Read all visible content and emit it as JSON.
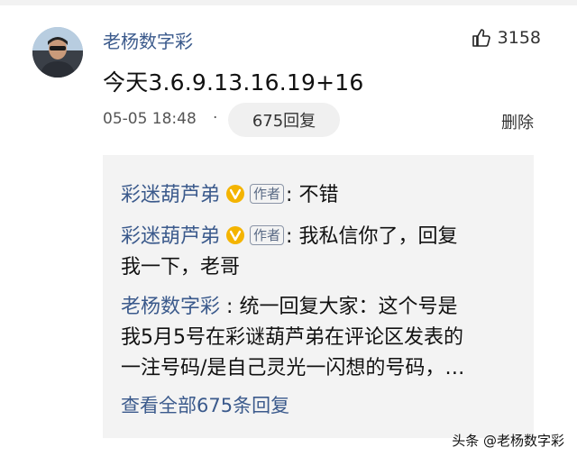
{
  "comment": {
    "username": "老杨数字彩",
    "like_count": "3158",
    "text": "今天3.6.9.13.16.19+16",
    "timestamp": "05-05 18:48",
    "separator": "·",
    "reply_count_label": "675回复",
    "delete_label": "删除"
  },
  "replies": [
    {
      "name": "彩迷葫芦弟",
      "tag": "作者",
      "text": "不错"
    },
    {
      "name": "彩迷葫芦弟",
      "tag": "作者",
      "text_line1": "我私信你了，回复",
      "text_line2": "我一下，老哥"
    },
    {
      "name": "老杨数字彩",
      "text_line1": "统一回复大家：这个号是",
      "text_line2": "我5月5号在彩谜葫芦弟在评论区发表的",
      "text_line3": "一注号码/是自己灵光一闪想的号码，…"
    }
  ],
  "colon": ":",
  "view_all_label": "查看全部675条回复",
  "watermark": "头条 @老杨数字彩",
  "colors": {
    "name": "#3b5a8c",
    "badge": "#f4b400",
    "reply_bg": "#f3f3f3"
  },
  "icons": {
    "like": "thumbs-up-icon",
    "verified": "verified-badge-icon"
  }
}
